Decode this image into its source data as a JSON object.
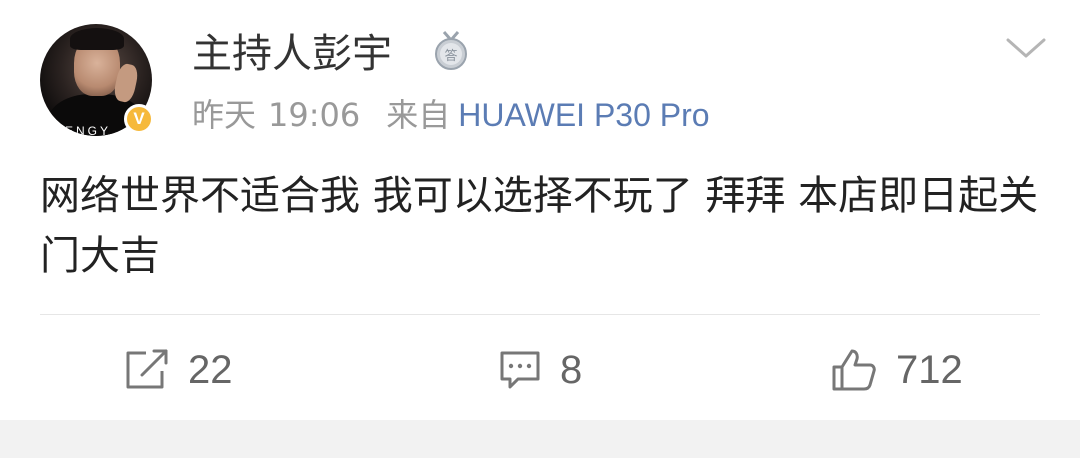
{
  "post": {
    "author": {
      "name": "主持人彭宇",
      "avatar_text": "PENGY",
      "verified_badge": "V",
      "medal_icon": "medal-icon",
      "colors": {
        "verified": "#f6b93b",
        "name": "#333333"
      }
    },
    "meta": {
      "day": "昨天",
      "time": "19:06",
      "source_prefix": "来自",
      "device": "HUAWEI P30 Pro",
      "device_color": "#5b7cb4"
    },
    "text": "网络世界不适合我 我可以选择不玩了  拜拜 本店即日起关门大吉",
    "menu_icon": "chevron-down-icon",
    "actions": {
      "repost": {
        "icon": "share-icon",
        "count": "22"
      },
      "comment": {
        "icon": "comment-icon",
        "count": "8"
      },
      "like": {
        "icon": "thumbs-up-icon",
        "count": "712"
      }
    }
  }
}
